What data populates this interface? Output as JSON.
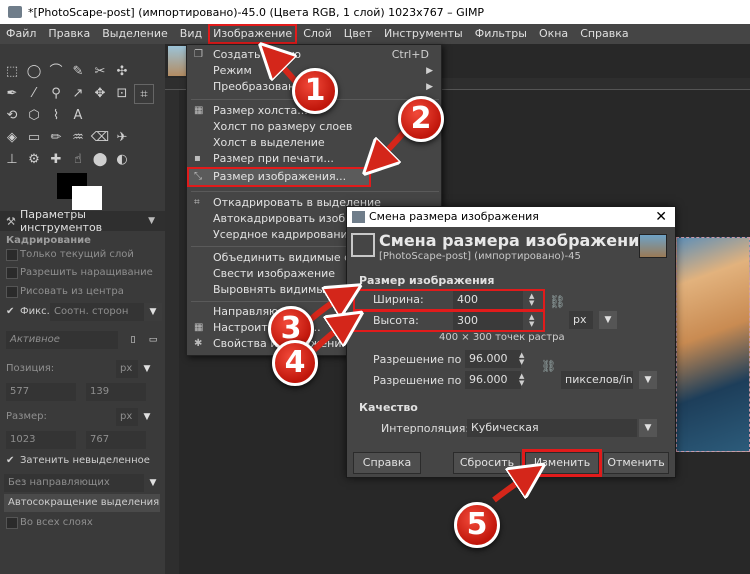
{
  "window": {
    "title": "*[PhotoScape-post] (импортировано)-45.0 (Цвета RGB, 1 слой) 1023x767 – GIMP"
  },
  "menubar": {
    "items": [
      "Файл",
      "Правка",
      "Выделение",
      "Вид",
      "Изображение",
      "Слой",
      "Цвет",
      "Инструменты",
      "Фильтры",
      "Окна",
      "Справка"
    ]
  },
  "image_menu": {
    "items": [
      {
        "label": "Создать копию",
        "shortcut": "Ctrl+D"
      },
      {
        "label": "Режим",
        "arrow": "▶"
      },
      {
        "label": "Преобразования",
        "arrow": "▶"
      },
      {
        "label": "Размер холста..."
      },
      {
        "label": "Холст по размеру слоев"
      },
      {
        "label": "Холст в выделение"
      },
      {
        "label": "Размер при печати..."
      },
      {
        "label": "Размер изображения..."
      },
      {
        "label": "Откадрировать в выделение"
      },
      {
        "label": "Автокадрировать изображение"
      },
      {
        "label": "Усердное кадрирование"
      },
      {
        "label": "Объединить видимые слои..."
      },
      {
        "label": "Свести изображение"
      },
      {
        "label": "Выровнять видимые слои..."
      },
      {
        "label": "Направляющие"
      },
      {
        "label": "Настроить сетку..."
      },
      {
        "label": "Свойства изображения"
      }
    ]
  },
  "tool_options": {
    "tab": "Параметры инструментов",
    "header": "Кадрирование",
    "only_current_layer": "Только текущий слой",
    "allow_growing": "Разрешить наращивание",
    "from_center": "Рисовать из центра",
    "fixed_label": "Фикс.:",
    "fixed_value": "Соотн. сторон",
    "active": "Активное",
    "position_label": "Позиция:",
    "position_unit": "px",
    "position_x": "577",
    "position_y": "139",
    "size_label": "Размер:",
    "size_unit": "px",
    "size_w": "1023",
    "size_h": "767",
    "darken": "Затенить невыделенное",
    "no_guides": "Без направляющих",
    "auto_shrink": "Автосокращение выделения",
    "all_layers": "Во всех слоях"
  },
  "dialog": {
    "window_title": "Смена размера изображения",
    "heading": "Смена размера изображения",
    "subheading": "[PhotoScape-post] (импортировано)-45",
    "section_size": "Размер изображения",
    "width_label": "Ширина:",
    "width_value": "400",
    "height_label": "Высота:",
    "height_value": "300",
    "unit": "px",
    "pixel_info": "400 × 300 точек растра",
    "res_x_label": "Разрешение по X:",
    "res_x_value": "96.000",
    "res_y_label": "Разрешение по Y:",
    "res_y_value": "96.000",
    "res_unit": "пикселов/in",
    "section_quality": "Качество",
    "interp_label": "Интерполяция:",
    "interp_value": "Кубическая",
    "btn_help": "Справка",
    "btn_reset": "Сбросить",
    "btn_resize": "Изменить",
    "btn_cancel": "Отменить"
  },
  "badges": [
    "1",
    "2",
    "3",
    "4",
    "5"
  ],
  "colors": {
    "annotation_red": "#e11b1b",
    "badge_red": "#d4261a"
  }
}
